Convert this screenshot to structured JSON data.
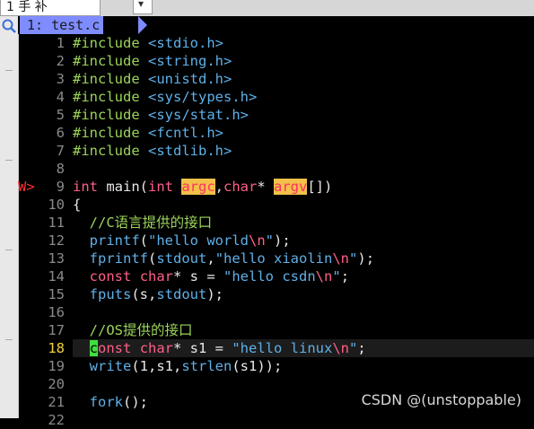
{
  "window": {
    "tab_label": "1 手 补",
    "button_label": "▾"
  },
  "buffer_tab": {
    "label": "1: test.c"
  },
  "colors": {
    "background": "#000000",
    "buffer_tab": "#7f8cff",
    "preproc": "#9cd45a",
    "type_keyword": "#ff5f87",
    "string": "#5fb0e8",
    "line_number": "#8a8a8a",
    "current_line_number": "#f0d040",
    "search_highlight": "#f2c14a",
    "cursor": "#3fe03f"
  },
  "sign_column": {
    "line_9": "W>"
  },
  "cursor": {
    "line": 18,
    "column": 5
  },
  "lines": [
    {
      "n": "1",
      "text": "#include <stdio.h>"
    },
    {
      "n": "2",
      "text": "#include <string.h>"
    },
    {
      "n": "3",
      "text": "#include <unistd.h>"
    },
    {
      "n": "4",
      "text": "#include <sys/types.h>"
    },
    {
      "n": "5",
      "text": "#include <sys/stat.h>"
    },
    {
      "n": "6",
      "text": "#include <fcntl.h>"
    },
    {
      "n": "7",
      "text": "#include <stdlib.h>"
    },
    {
      "n": "8",
      "text": ""
    },
    {
      "n": "9",
      "text": "int main(int argc,char* argv[])"
    },
    {
      "n": "10",
      "text": "{"
    },
    {
      "n": "11",
      "text": "  //C语言提供的接口"
    },
    {
      "n": "12",
      "text": "  printf(\"hello world\\n\");"
    },
    {
      "n": "13",
      "text": "  fprintf(stdout,\"hello xiaolin\\n\");"
    },
    {
      "n": "14",
      "text": "  const char* s = \"hello csdn\\n\";"
    },
    {
      "n": "15",
      "text": "  fputs(s,stdout);"
    },
    {
      "n": "16",
      "text": ""
    },
    {
      "n": "17",
      "text": "  //OS提供的接口"
    },
    {
      "n": "18",
      "text": "  const char* s1 = \"hello linux\\n\";"
    },
    {
      "n": "19",
      "text": "  write(1,s1,strlen(s1));"
    },
    {
      "n": "20",
      "text": ""
    },
    {
      "n": "21",
      "text": "  fork();"
    },
    {
      "n": "22",
      "text": ""
    }
  ],
  "tokens": {
    "l1": [
      "#include",
      " ",
      "<stdio.h>"
    ],
    "l2": [
      "#include",
      " ",
      "<string.h>"
    ],
    "l3": [
      "#include",
      " ",
      "<unistd.h>"
    ],
    "l4": [
      "#include",
      " ",
      "<sys/types.h>"
    ],
    "l5": [
      "#include",
      " ",
      "<sys/stat.h>"
    ],
    "l6": [
      "#include",
      " ",
      "<fcntl.h>"
    ],
    "l7": [
      "#include",
      " ",
      "<stdlib.h>"
    ],
    "l9": [
      "int",
      " main(",
      "int",
      " ",
      "argc",
      ",",
      "char",
      "* ",
      "argv",
      "[])"
    ],
    "l10": [
      "{"
    ],
    "l11": [
      "  ",
      "//C语言提供的接口"
    ],
    "l12": [
      "  ",
      "printf",
      "(",
      "\"hello world",
      "\\n",
      "\"",
      ");"
    ],
    "l13": [
      "  ",
      "fprintf",
      "(",
      "stdout",
      ",",
      "\"hello xiaolin",
      "\\n",
      "\"",
      ");"
    ],
    "l14": [
      "  ",
      "const",
      " ",
      "char",
      "* s = ",
      "\"hello csdn",
      "\\n",
      "\"",
      ";"
    ],
    "l15": [
      "  ",
      "fputs",
      "(s,",
      "stdout",
      ");"
    ],
    "l17": [
      "  ",
      "//OS提供的接口"
    ],
    "l18": [
      "  ",
      "c",
      "onst",
      " ",
      "char",
      "* s1 = ",
      "\"hello linux",
      "\\n",
      "\"",
      ";"
    ],
    "l19": [
      "  ",
      "write",
      "(1,s1,",
      "strlen",
      "(s1));"
    ],
    "l21": [
      "  ",
      "fork",
      "();"
    ]
  },
  "watermark": "CSDN @(unstoppable)"
}
